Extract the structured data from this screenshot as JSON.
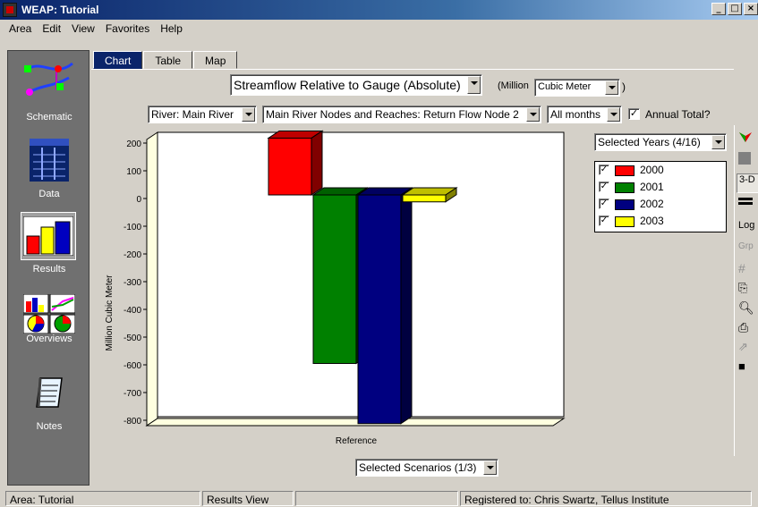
{
  "window": {
    "title": "WEAP: Tutorial",
    "buttons": {
      "minimize": "_",
      "maximize": "□",
      "close": "×"
    }
  },
  "menu": [
    "Area",
    "Edit",
    "View",
    "Favorites",
    "Help"
  ],
  "sidebar": {
    "items": [
      {
        "label": "Schematic",
        "icon": "schematic-icon"
      },
      {
        "label": "Data",
        "icon": "data-icon"
      },
      {
        "label": "Results",
        "icon": "results-icon",
        "selected": true
      },
      {
        "label": "Overviews",
        "icon": "overviews-icon"
      },
      {
        "label": "Notes",
        "icon": "notes-icon"
      }
    ]
  },
  "tabs": [
    {
      "label": "Chart",
      "active": true
    },
    {
      "label": "Table"
    },
    {
      "label": "Map"
    }
  ],
  "controls": {
    "result_type": "Streamflow Relative to Gauge (Absolute)",
    "unit_prefix": "(Million",
    "unit": "Cubic Meter",
    "unit_suffix": ")",
    "river": "River: Main River",
    "node": "Main River Nodes and Reaches: Return Flow Node 2",
    "months": "All months",
    "annual_total_label": "Annual Total?",
    "annual_total_checked": true,
    "years_selector": "Selected Years (4/16)",
    "scenarios_selector": "Selected Scenarios (1/3)"
  },
  "right_toolbar": [
    "3-D",
    "Log",
    "Grp"
  ],
  "colors": {
    "2000": "#ff0000",
    "2001": "#008000",
    "2002": "#000080",
    "2003": "#ffff00",
    "chart_bg": "#ffffff",
    "sidebar_bg": "#707070",
    "accent": "#0a246a"
  },
  "chart_data": {
    "type": "bar",
    "style": "3d-clustered",
    "categories": [
      "Reference"
    ],
    "series": [
      {
        "name": "2000",
        "values": [
          205
        ],
        "color": "#ff0000"
      },
      {
        "name": "2001",
        "values": [
          -608
        ],
        "color": "#008000"
      },
      {
        "name": "2002",
        "values": [
          -825
        ],
        "color": "#000080"
      },
      {
        "name": "2003",
        "values": [
          -25
        ],
        "color": "#ffff00"
      }
    ],
    "ylabel": "Million Cubic Meter",
    "ylim": [
      -800,
      200
    ],
    "yticks": [
      200,
      100,
      0,
      -100,
      -200,
      -300,
      -400,
      -500,
      -600,
      -700,
      -800
    ],
    "legend": "right"
  },
  "status": {
    "area": "Area: Tutorial",
    "view": "Results View",
    "empty": "",
    "registered": "Registered to: Chris Swartz, Tellus Institute"
  }
}
